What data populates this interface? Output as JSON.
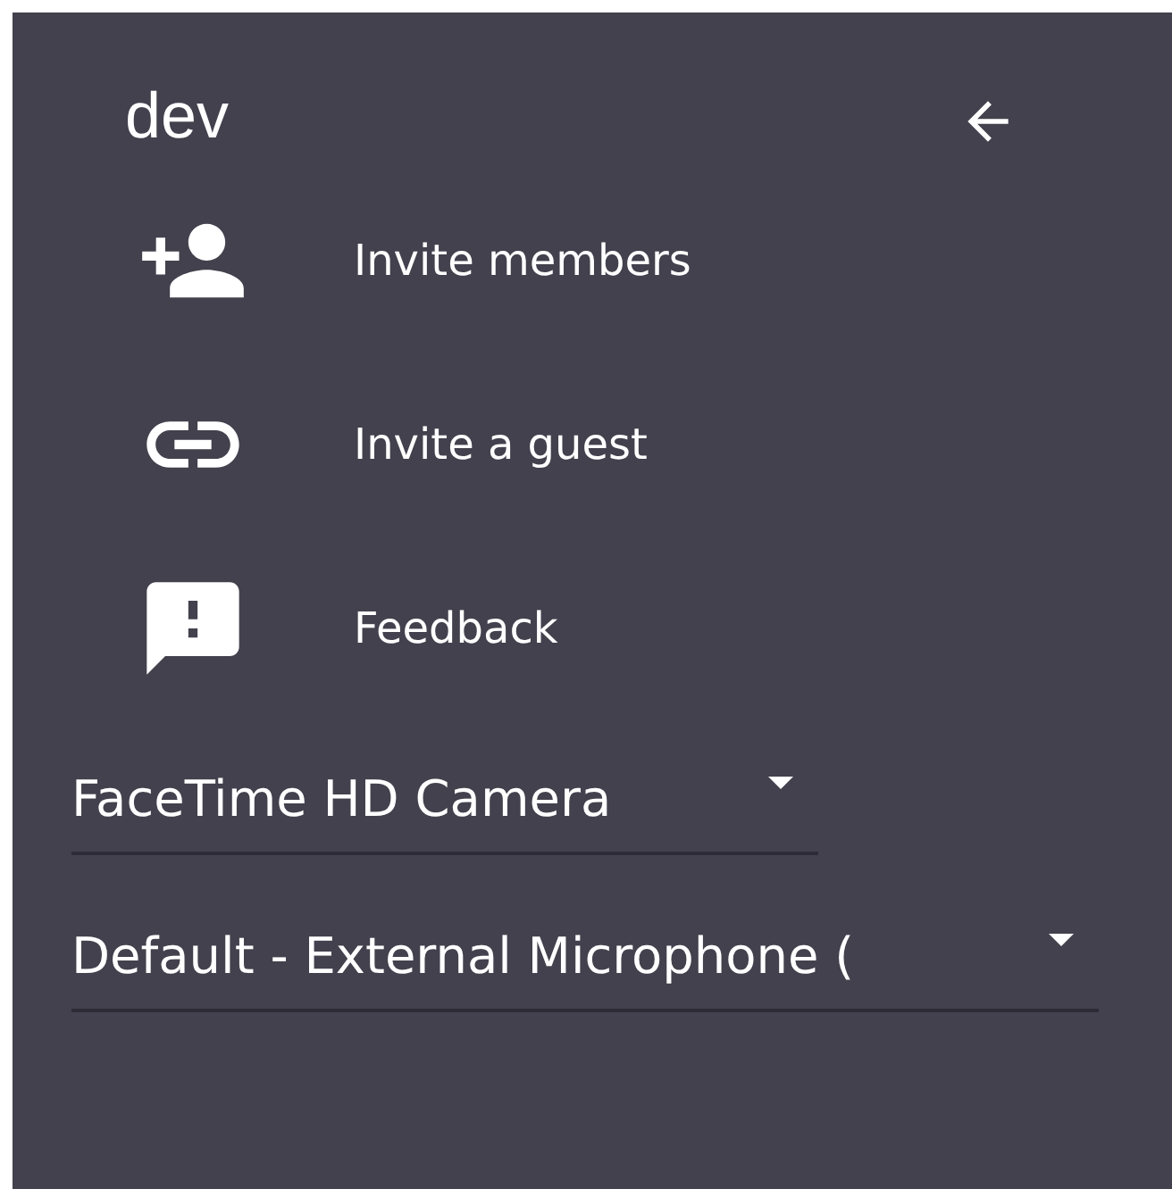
{
  "header": {
    "title": "dev"
  },
  "menu": [
    {
      "kind": "invite",
      "label": "Invite members"
    },
    {
      "kind": "link",
      "label": "Invite a guest"
    },
    {
      "kind": "feedback",
      "label": "Feedback"
    }
  ],
  "selects": [
    {
      "kind": "camera",
      "value": "FaceTime HD Camera"
    },
    {
      "kind": "microphone",
      "value": "Default - External Microphone ("
    }
  ]
}
